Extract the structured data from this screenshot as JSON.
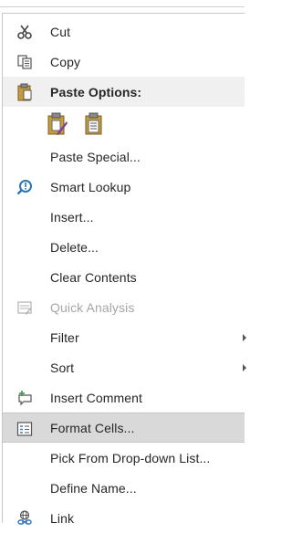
{
  "menu": {
    "cut": {
      "label": "Cut",
      "icon": "scissors-icon"
    },
    "copy": {
      "label": "Copy",
      "icon": "copy-icon"
    },
    "paste_options": {
      "label": "Paste Options:",
      "icon": "clipboard-icon"
    },
    "paste_buttons": [
      "paste-formatting-icon",
      "paste-values-icon"
    ],
    "paste_special": {
      "label": "Paste Special..."
    },
    "smart_lookup": {
      "label": "Smart Lookup",
      "icon": "smart-lookup-icon"
    },
    "insert": {
      "label": "Insert..."
    },
    "delete": {
      "label": "Delete..."
    },
    "clear_contents": {
      "label": "Clear Contents"
    },
    "quick_analysis": {
      "label": "Quick Analysis",
      "icon": "quick-analysis-icon"
    },
    "filter": {
      "label": "Filter"
    },
    "sort": {
      "label": "Sort"
    },
    "insert_comment": {
      "label": "Insert Comment",
      "icon": "comment-icon"
    },
    "format_cells": {
      "label": "Format Cells...",
      "icon": "format-cells-icon"
    },
    "pick_dropdown": {
      "label": "Pick From Drop-down List..."
    },
    "define_name": {
      "label": "Define Name..."
    },
    "link": {
      "label": "Link",
      "icon": "link-icon"
    }
  },
  "colors": {
    "highlight": "#d9d9d9",
    "accent_blue": "#2e75b6",
    "paste_gold": "#c59d3d"
  }
}
